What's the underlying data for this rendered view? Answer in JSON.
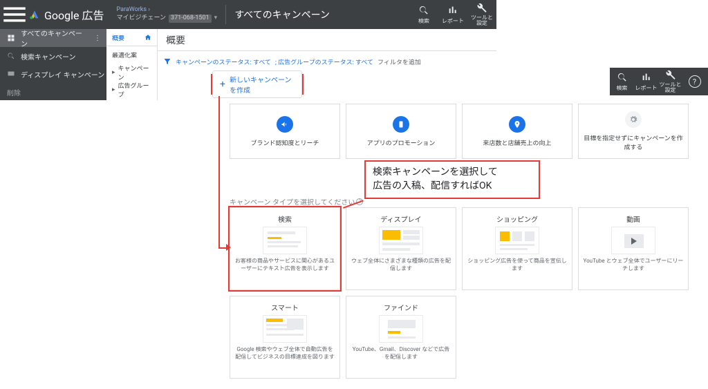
{
  "header": {
    "product": "Google 広告",
    "account_parent": "ParaWorks",
    "account_name": "マイビジチェーン",
    "account_id": "371-068-1501",
    "title": "すべてのキャンペーン",
    "icons": {
      "search": "検索",
      "reports": "レポート",
      "tools": "ツールと\n設定"
    }
  },
  "leftnav": {
    "all_campaigns": "すべてのキャンペーン",
    "search_campaign": "検索キャンペーン",
    "display_campaign": "ディスプレイ キャンペーン",
    "deleted": "削除"
  },
  "subnav": {
    "overview": "概要",
    "optimization": "最適化案",
    "campaigns": "キャンペーン",
    "adgroups": "広告グループ"
  },
  "main": {
    "title": "概要",
    "filter_prefix": "キャンペーンのステータス: すべて",
    "filter_mid": "; 広告グループのステータス: すべて",
    "filter_add": "フィルタを追加",
    "new_button": "新しいキャンペーンを作成",
    "section_label": "キャンペーン タイプを選択してください"
  },
  "goal_cards": [
    {
      "label": "ブランド認知度とリーチ",
      "icon": "megaphone"
    },
    {
      "label": "アプリのプロモーション",
      "icon": "phone"
    },
    {
      "label": "来店数と店舗売上の向上",
      "icon": "pin"
    },
    {
      "label": "目標を指定せずにキャンペーンを作成する",
      "icon": "gear"
    }
  ],
  "type_cards": [
    {
      "title": "検索",
      "desc": "お客様の商品やサービスに関心があるユーザーにテキスト広告を表示します",
      "thumb": "search"
    },
    {
      "title": "ディスプレイ",
      "desc": "ウェブ全体にさまざまな種類の広告を配信します",
      "thumb": "display"
    },
    {
      "title": "ショッピング",
      "desc": "ショッピング広告を使って商品を宣伝します",
      "thumb": "shopping"
    },
    {
      "title": "動画",
      "desc": "YouTube とウェブ全体でユーザーにリーチします",
      "thumb": "video"
    },
    {
      "title": "スマート",
      "desc": "Google 検索やウェブ全体で自動広告を配信してビジネスの目標達成を図ります",
      "thumb": "smart"
    },
    {
      "title": "ファインド",
      "desc": "YouTube、Gmail、Discover などで広告を配信します",
      "thumb": "find"
    }
  ],
  "annotation": "検索キャンペーンを選択して\n広告の入稿、配信すればOK"
}
